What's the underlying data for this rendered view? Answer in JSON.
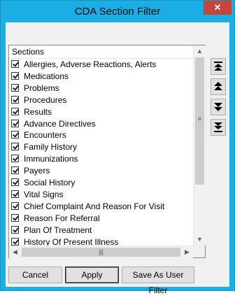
{
  "window": {
    "title": "CDA Section Filter",
    "close_glyph": "✕"
  },
  "list": {
    "header": "Sections",
    "items": [
      {
        "label": "Allergies, Adverse Reactions, Alerts",
        "checked": true
      },
      {
        "label": "Medications",
        "checked": true
      },
      {
        "label": "Problems",
        "checked": true
      },
      {
        "label": "Procedures",
        "checked": true
      },
      {
        "label": "Results",
        "checked": true
      },
      {
        "label": "Advance Directives",
        "checked": true
      },
      {
        "label": "Encounters",
        "checked": true
      },
      {
        "label": "Family History",
        "checked": true
      },
      {
        "label": "Immunizations",
        "checked": true
      },
      {
        "label": "Payers",
        "checked": true
      },
      {
        "label": "Social History",
        "checked": true
      },
      {
        "label": "Vital Signs",
        "checked": true
      },
      {
        "label": "Chief Complaint And Reason For Visit",
        "checked": true
      },
      {
        "label": "Reason For Referral",
        "checked": true
      },
      {
        "label": "Plan Of Treatment",
        "checked": true
      },
      {
        "label": "History Of Present Illness",
        "checked": true
      }
    ]
  },
  "move_buttons": [
    {
      "name": "move-to-top-icon"
    },
    {
      "name": "move-up-icon"
    },
    {
      "name": "move-down-icon"
    },
    {
      "name": "move-to-bottom-icon"
    }
  ],
  "buttons": {
    "cancel": "Cancel",
    "apply": "Apply",
    "save_user_filter": "Save As User Filter"
  },
  "colors": {
    "title_bar": "#1aaee5",
    "close": "#c7443b"
  }
}
